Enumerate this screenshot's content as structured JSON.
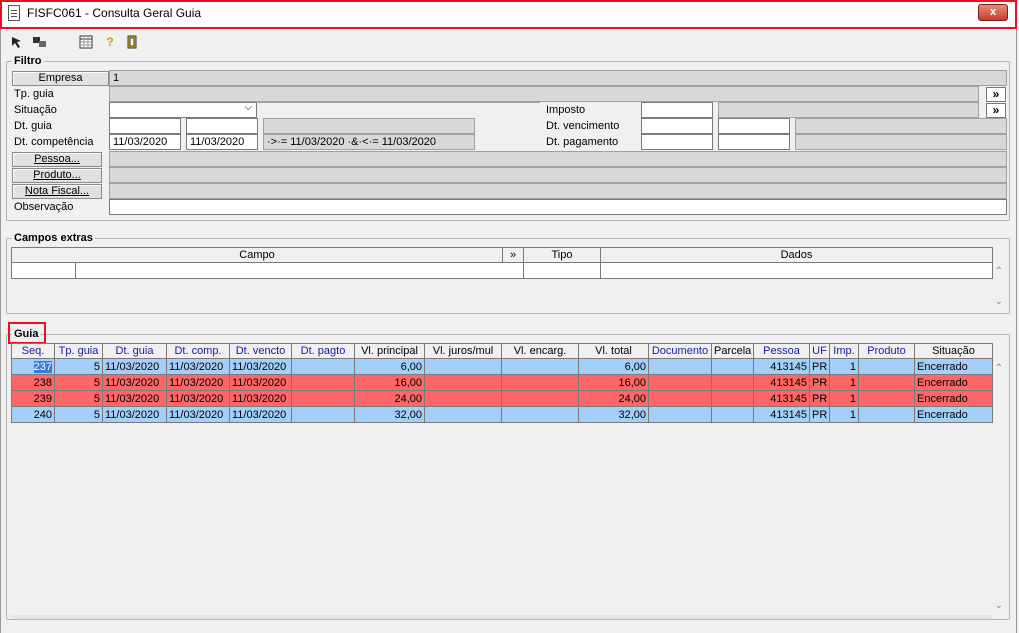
{
  "window": {
    "title": "FISFC061 - Consulta Geral Guia",
    "close": "x"
  },
  "toolbar": {
    "icon_help": "?"
  },
  "filtro": {
    "title": "Filtro",
    "empresa_btn": "Empresa",
    "empresa_value": "1",
    "tp_guia_label": "Tp. guia",
    "situacao_label": "Situação",
    "imposto_label": "Imposto",
    "dt_guia_label": "Dt. guia",
    "dt_vencimento_label": "Dt. vencimento",
    "dt_competencia_label": "Dt. competência",
    "dt_comp_from": "11/03/2020",
    "dt_comp_to": "11/03/2020",
    "dt_comp_expr": "·>·= 11/03/2020 ·&·<·= 11/03/2020",
    "dt_pagamento_label": "Dt. pagamento",
    "pessoa_btn": "Pessoa...",
    "produto_btn": "Produto...",
    "nota_btn": "Nota Fiscal...",
    "observacao_label": "Observação",
    "more": "»"
  },
  "campos": {
    "title": "Campos extras",
    "headers": {
      "campo": "Campo",
      "more": "»",
      "tipo": "Tipo",
      "dados": "Dados"
    }
  },
  "guia": {
    "title": "Guia",
    "headers": [
      "Seq.",
      "Tp. guia",
      "Dt. guia",
      "Dt. comp.",
      "Dt. vencto",
      "Dt. pagto",
      "Vl. principal",
      "Vl. juros/mul",
      "Vl. encarg.",
      "Vl. total",
      "Documento",
      "Parcela",
      "Pessoa",
      "UF",
      "Imp.",
      "Produto",
      "Situação"
    ],
    "rows": [
      {
        "seq": "237",
        "tp": "5",
        "dt_guia": "11/03/2020",
        "dt_comp": "11/03/2020",
        "dt_vencto": "11/03/2020",
        "principal": "6,00",
        "total": "6,00",
        "pessoa": "413145",
        "uf": "PR",
        "imp": "1",
        "situacao": "Encerrado"
      },
      {
        "seq": "238",
        "tp": "5",
        "dt_guia": "11/03/2020",
        "dt_comp": "11/03/2020",
        "dt_vencto": "11/03/2020",
        "principal": "16,00",
        "total": "16,00",
        "pessoa": "413145",
        "uf": "PR",
        "imp": "1",
        "situacao": "Encerrado"
      },
      {
        "seq": "239",
        "tp": "5",
        "dt_guia": "11/03/2020",
        "dt_comp": "11/03/2020",
        "dt_vencto": "11/03/2020",
        "principal": "24,00",
        "total": "24,00",
        "pessoa": "413145",
        "uf": "PR",
        "imp": "1",
        "situacao": "Encerrado"
      },
      {
        "seq": "240",
        "tp": "5",
        "dt_guia": "11/03/2020",
        "dt_comp": "11/03/2020",
        "dt_vencto": "11/03/2020",
        "principal": "32,00",
        "total": "32,00",
        "pessoa": "413145",
        "uf": "PR",
        "imp": "1",
        "situacao": "Encerrado"
      }
    ]
  }
}
